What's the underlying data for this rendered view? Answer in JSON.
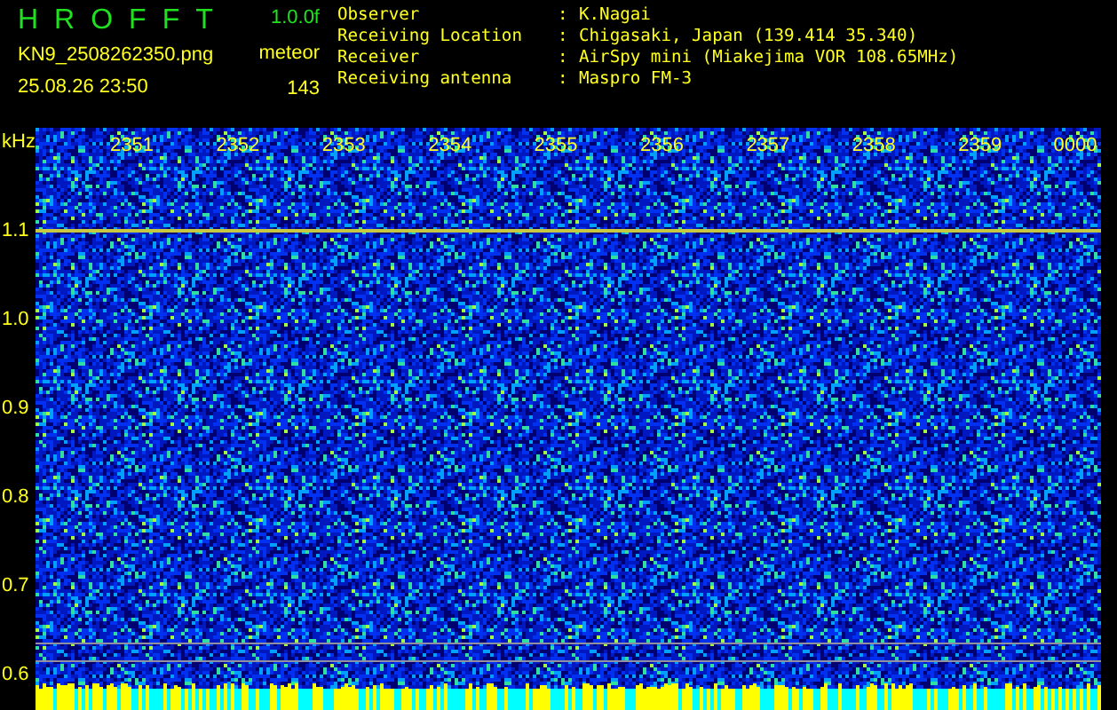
{
  "header": {
    "title": "HROFFT",
    "version": "1.0.0f",
    "file_name": "KN9_2508262350.png",
    "timestamp": "25.08.26 23:50",
    "mode": "meteor",
    "count": "143"
  },
  "station_info": [
    {
      "label": "Observer",
      "separator": ":",
      "value": "K.Nagai"
    },
    {
      "label": "Receiving Location",
      "separator": ":",
      "value": "Chigasaki, Japan (139.414 35.340)"
    },
    {
      "label": "Receiver",
      "separator": ":",
      "value": "AirSpy mini (Miakejima VOR 108.65MHz)"
    },
    {
      "label": "Receiving antenna",
      "separator": ":",
      "value": "Maspro FM-3"
    }
  ],
  "spectrogram": {
    "y_unit": "kHz",
    "y_labels": [
      "1.1",
      "1.0",
      "0.9",
      "0.8",
      "0.7",
      "0.6"
    ],
    "time_labels": [
      "2351",
      "2352",
      "2353",
      "2354",
      "2355",
      "2356",
      "2357",
      "2358",
      "2359",
      "0000"
    ]
  }
}
